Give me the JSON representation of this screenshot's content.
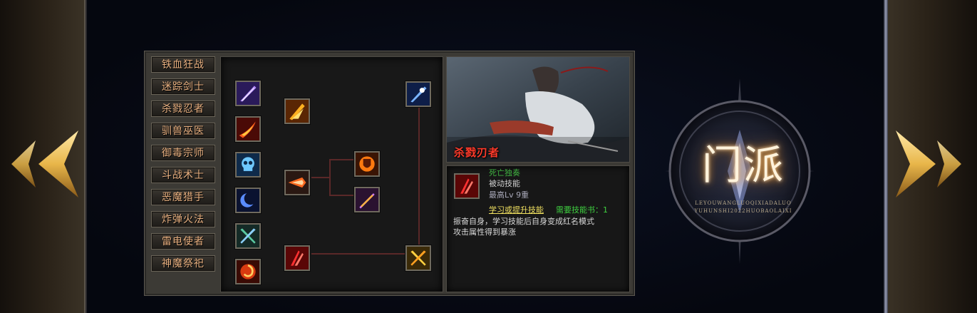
{
  "colors": {
    "class_text": "#e8b080",
    "skill_name": "#3fb040",
    "portrait_name": "#ff3a2a",
    "learn_link": "#f0e060",
    "book_label": "#3fd040"
  },
  "classes": [
    {
      "label": "铁血狂战"
    },
    {
      "label": "迷踪剑士"
    },
    {
      "label": "杀戮忍者"
    },
    {
      "label": "驯兽巫医"
    },
    {
      "label": "御毒宗师"
    },
    {
      "label": "斗战术士"
    },
    {
      "label": "恶魔猎手"
    },
    {
      "label": "炸弹火法"
    },
    {
      "label": "雷电使者"
    },
    {
      "label": "神魔祭祀"
    }
  ],
  "skill_tree": {
    "icons": [
      "blade-icon",
      "fire-slash-icon",
      "ice-skull-icon",
      "crescent-moon-icon",
      "green-cross-blade-icon",
      "fire-swirl-icon",
      "flame-burst-icon",
      "fire-dash-icon",
      "flame-shield-icon",
      "violet-blade-icon",
      "blood-claw-icon",
      "blue-star-blade-icon",
      "gold-cross-icon"
    ]
  },
  "portrait": {
    "name": "杀戮刃者"
  },
  "skill_info": {
    "icon": "blood-claw-icon",
    "name": "死亡独奏",
    "type": "被动技能",
    "max_level": "最高Lv 9重",
    "learn_link": "学习或提升技能",
    "book_label": "需要技能书：1",
    "desc_line1": "振奋自身，学习技能后自身变成红名模式",
    "desc_line2": "攻击属性得到暴涨"
  },
  "emblem": {
    "title": "门派",
    "sub_line1": "LEYOUWANGLUOQIXIADALUO",
    "sub_line2": "YUHUNSHI2022HUOBAOLAIXI"
  }
}
